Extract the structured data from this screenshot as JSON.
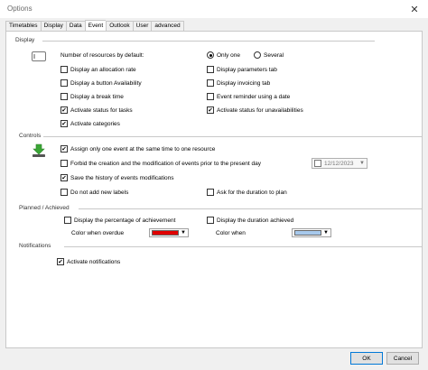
{
  "window": {
    "title": "Options",
    "close_glyph": "✕"
  },
  "tabs": [
    {
      "label": "Timetables",
      "active": false
    },
    {
      "label": "Display",
      "active": false
    },
    {
      "label": "Data",
      "active": false
    },
    {
      "label": "Event",
      "active": true
    },
    {
      "label": "Outlook",
      "active": false
    },
    {
      "label": "User",
      "active": false
    },
    {
      "label": "advanced",
      "active": false
    }
  ],
  "display": {
    "label": "Display",
    "icon": "resource-icon",
    "resources_label": "Number of resources by default:",
    "radio_only_one": {
      "label": "Only one",
      "checked": true
    },
    "radio_several": {
      "label": "Several",
      "checked": false
    },
    "cb_allocation_rate": {
      "label": "Display an allocation rate",
      "checked": false
    },
    "cb_button_availability": {
      "label": "Display a button Availability",
      "checked": false
    },
    "cb_break_time": {
      "label": "Display a break time",
      "checked": false
    },
    "cb_status_tasks": {
      "label": "Activate status for tasks",
      "checked": true
    },
    "cb_categories": {
      "label": "Activate categories",
      "checked": true
    },
    "cb_parameters_tab": {
      "label": "Display parameters tab",
      "checked": false
    },
    "cb_invoicing_tab": {
      "label": "Display invoicing tab",
      "checked": false
    },
    "cb_event_reminder": {
      "label": "Event reminder using a date",
      "checked": false
    },
    "cb_status_unavail": {
      "label": "Activate status for unavailabilities",
      "checked": true
    }
  },
  "controls": {
    "label": "Controls",
    "icon": "download-tray-icon",
    "cb_only_one_event": {
      "label": "Assign only one event at the same time to one resource",
      "checked": true
    },
    "cb_forbid_before": {
      "label": "Forbid the creation and the modification of events prior to the present day",
      "checked": false
    },
    "date_value": "12/12/2023",
    "cb_save_history": {
      "label": "Save the history of events modifications",
      "checked": true
    },
    "cb_no_new_labels": {
      "label": "Do not add new labels",
      "checked": false
    },
    "cb_ask_duration": {
      "label": "Ask for the duration to plan",
      "checked": false
    }
  },
  "planned": {
    "label": "Planned / Achieved",
    "cb_percentage": {
      "label": "Display the percentage of achievement",
      "checked": false
    },
    "cb_duration_achieved": {
      "label": "Display the duration achieved",
      "checked": false
    },
    "color_overdue_label": "Color when overdue",
    "color_overdue": "#e00000",
    "color_when_label": "Color when",
    "color_when": "#a7c9ec"
  },
  "notifications": {
    "label": "Notifications",
    "cb_activate": {
      "label": "Activate notifications",
      "checked": true
    }
  },
  "footer": {
    "ok": "OK",
    "cancel": "Cancel"
  },
  "colors": {
    "panel_border": "#c8c8c8",
    "accent": "#0078d7",
    "icon_green": "#3aa635"
  }
}
